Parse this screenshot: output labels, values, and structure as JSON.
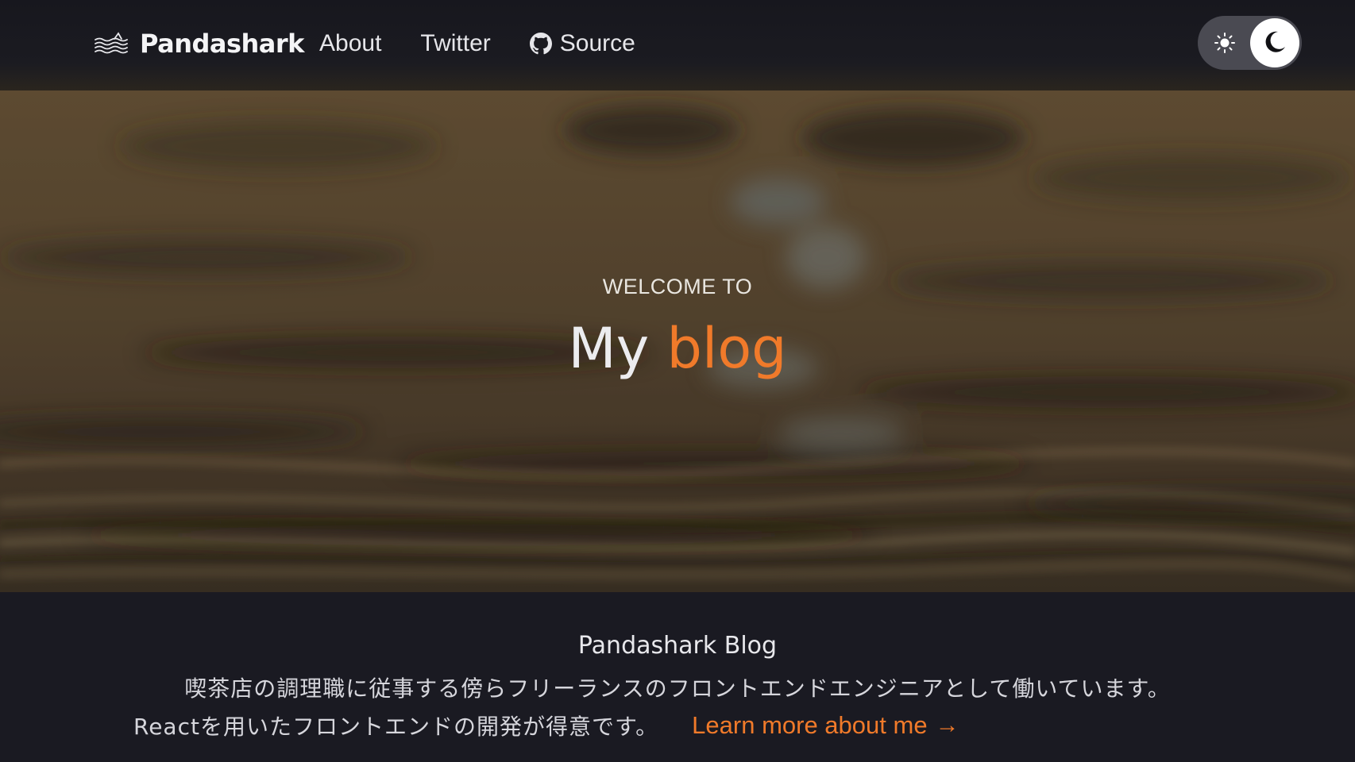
{
  "header": {
    "brand": {
      "name": "Pandashark",
      "logo_icon": "waves-logo-icon"
    },
    "nav": [
      {
        "label": "About"
      },
      {
        "label": "Twitter"
      },
      {
        "label": "Source",
        "icon": "github-icon"
      }
    ],
    "theme_toggle": {
      "light_icon": "sun-icon",
      "dark_icon": "moon-icon",
      "state": "dark"
    }
  },
  "hero": {
    "kicker": "WELCOME TO",
    "title_part1": "My ",
    "title_part2": "blog"
  },
  "intro": {
    "title": "Pandashark Blog",
    "line1": "喫茶店の調理職に従事する傍らフリーランスのフロントエンドエンジニアとして働いています。",
    "line2": "Reactを用いたフロントエンドの開発が得意です。",
    "link_label": "Learn more about me",
    "link_arrow": "→"
  },
  "colors": {
    "accent": "#f07a2a",
    "background": "#1a1a22",
    "header": "#17171e"
  }
}
